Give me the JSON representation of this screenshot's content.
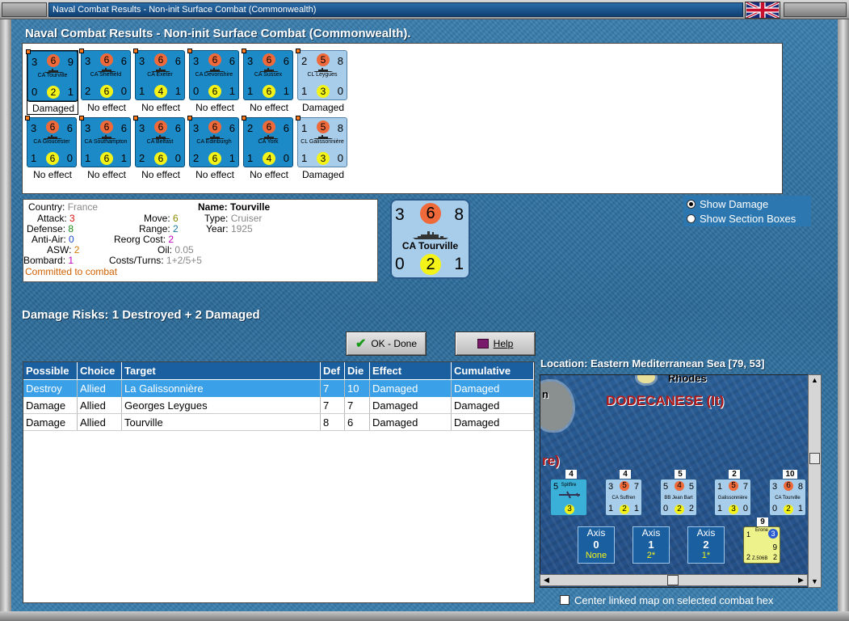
{
  "window": {
    "title": "Naval Combat Results - Non-init Surface Combat (Commonwealth)"
  },
  "heading": "Naval Combat Results - Non-init Surface Combat (Commonwealth).",
  "units": [
    {
      "tl": "3",
      "att": "6",
      "tr": "9",
      "name": "CA Tourville",
      "bl": "0",
      "def": "2",
      "br": "1",
      "result": "Damaged",
      "style": "dark",
      "selected": true
    },
    {
      "tl": "3",
      "att": "6",
      "tr": "6",
      "name": "CA Sheffield",
      "bl": "2",
      "def": "6",
      "br": "0",
      "result": "No effect",
      "style": "dark"
    },
    {
      "tl": "3",
      "att": "6",
      "tr": "6",
      "name": "CA Exeter",
      "bl": "1",
      "def": "4",
      "br": "1",
      "result": "No effect",
      "style": "dark"
    },
    {
      "tl": "3",
      "att": "6",
      "tr": "6",
      "name": "CA Devonshire",
      "bl": "0",
      "def": "6",
      "br": "1",
      "result": "No effect",
      "style": "dark"
    },
    {
      "tl": "3",
      "att": "6",
      "tr": "6",
      "name": "CA Sussex",
      "bl": "1",
      "def": "6",
      "br": "1",
      "result": "No effect",
      "style": "dark"
    },
    {
      "tl": "2",
      "att": "5",
      "tr": "8",
      "name": "CL Leygues",
      "bl": "1",
      "def": "3",
      "br": "0",
      "result": "Damaged",
      "style": "light"
    },
    {
      "tl": "3",
      "att": "6",
      "tr": "6",
      "name": "CA Gloucester",
      "bl": "1",
      "def": "6",
      "br": "0",
      "result": "No effect",
      "style": "dark"
    },
    {
      "tl": "3",
      "att": "6",
      "tr": "6",
      "name": "CA Southampton",
      "bl": "1",
      "def": "6",
      "br": "1",
      "result": "No effect",
      "style": "dark"
    },
    {
      "tl": "3",
      "att": "6",
      "tr": "6",
      "name": "CA Belfast",
      "bl": "2",
      "def": "6",
      "br": "0",
      "result": "No effect",
      "style": "dark"
    },
    {
      "tl": "3",
      "att": "6",
      "tr": "6",
      "name": "CA Edinburgh",
      "bl": "2",
      "def": "6",
      "br": "1",
      "result": "No effect",
      "style": "dark"
    },
    {
      "tl": "2",
      "att": "6",
      "tr": "6",
      "name": "CA York",
      "bl": "1",
      "def": "4",
      "br": "0",
      "result": "No effect",
      "style": "dark"
    },
    {
      "tl": "1",
      "att": "5",
      "tr": "8",
      "name": "CL Galissonnière",
      "bl": "1",
      "def": "3",
      "br": "0",
      "result": "Damaged",
      "style": "light"
    }
  ],
  "info": {
    "country_label": "Country:",
    "country": "France",
    "attack_label": "Attack:",
    "attack": "3",
    "defense_label": "Defense:",
    "defense": "8",
    "antiair_label": "Anti-Air:",
    "antiair": "0",
    "asw_label": "ASW:",
    "asw": "2",
    "bombard_label": "Bombard:",
    "bombard": "1",
    "name_label": "Name:",
    "name": "Tourville",
    "type_label": "Type:",
    "type": "Cruiser",
    "year_label": "Year:",
    "year": "1925",
    "move_label": "Move:",
    "move": "6",
    "range_label": "Range:",
    "range": "2",
    "reorg_label": "Reorg Cost:",
    "reorg": "2",
    "oil_label": "Oil:",
    "oil": "0.05",
    "costs_label": "Costs/Turns:",
    "costs": "1+2/5+5",
    "status": "Committed to combat"
  },
  "big_counter": {
    "tl": "3",
    "att": "6",
    "tr": "8",
    "name": "CA Tourville",
    "bl": "0",
    "def": "2",
    "br": "1"
  },
  "radio": {
    "show_damage": "Show Damage",
    "show_section": "Show Section Boxes"
  },
  "damage_risks": "Damage Risks:  1 Destroyed + 2 Damaged",
  "buttons": {
    "ok": "OK - Done",
    "help": "Help"
  },
  "table": {
    "headers": [
      "Possible",
      "Choice",
      "Target",
      "Def",
      "Die",
      "Effect",
      "Cumulative"
    ],
    "rows": [
      [
        "Destroy",
        "Allied",
        "La Galissonnière",
        "7",
        "10",
        "Damaged",
        "Damaged"
      ],
      [
        "Damage",
        "Allied",
        "Georges Leygues",
        "7",
        "7",
        "Damaged",
        "Damaged"
      ],
      [
        "Damage",
        "Allied",
        "Tourville",
        "8",
        "6",
        "Damaged",
        "Damaged"
      ]
    ]
  },
  "location": "Location:  Eastern Mediterranean Sea [79, 53]",
  "map": {
    "labels": {
      "rhodes": "Rhodes",
      "dodecanese": "DODECANESE (It)",
      "re": "re)",
      "n": "n"
    },
    "stacks": [
      {
        "count": "4",
        "tl": "5",
        "name": "Spitfire",
        "def": "3",
        "style": "dark"
      },
      {
        "count": "4",
        "tl": "3",
        "att": "5",
        "tr": "7",
        "name": "CA Suffren",
        "bl": "1",
        "def": "2",
        "br": "1",
        "style": "light"
      },
      {
        "count": "5",
        "tl": "5",
        "att": "4",
        "tr": "5",
        "name": "BB Jean Bart",
        "bl": "0",
        "def": "2",
        "br": "2",
        "style": "light"
      },
      {
        "count": "2",
        "tl": "1",
        "att": "5",
        "tr": "7",
        "name": "Galissonnière",
        "bl": "1",
        "def": "3",
        "br": "0",
        "style": "light"
      },
      {
        "count": "10",
        "tl": "3",
        "att": "6",
        "tr": "8",
        "name": "CA Tourville",
        "bl": "0",
        "def": "2",
        "br": "1",
        "style": "light"
      }
    ],
    "axis_boxes": [
      {
        "label": "Axis",
        "num": "0",
        "val": "None"
      },
      {
        "label": "Axis",
        "num": "1",
        "val": "2*"
      },
      {
        "label": "Axis",
        "num": "2",
        "val": "1*"
      }
    ],
    "erone": {
      "count": "9",
      "tl": "1",
      "name": "Erone",
      "att": "3",
      "mid": "9",
      "bl": "2",
      "bottom": "Z.506B",
      "br": "2"
    }
  },
  "center_checkbox": "Center linked map on selected combat hex",
  "colors": {
    "accent": "#1a5fa0",
    "selected_row": "#3aa0e8",
    "attack_circle": "#ef6a3a",
    "defense_circle": "#f3f31a"
  }
}
